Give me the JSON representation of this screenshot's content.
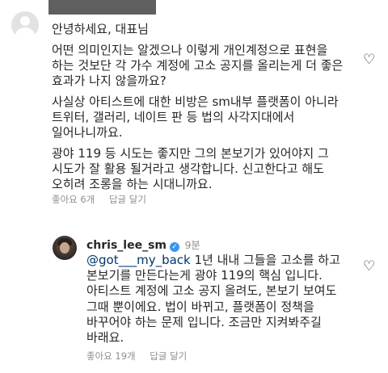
{
  "comment1": {
    "lines": [
      "안녕하세요, 대표님",
      "어떤 의미인지는 알겠으나 이렇게 개인계정으로 표현을 하는 것보단 각 가수 계정에 고소 공지를 올리는게 더 좋은 효과가 나지 않을까요?",
      "사실상 아티스트에 대한 비방은 sm내부 플랫폼이 아니라 트위터, 갤러리, 네이트 판 등 법의 사각지대에서 일어나니까요.",
      "광야 119 등 시도는 좋지만 그의 본보기가 있어야지 그 시도가 잘 활용 될거라고 생각합니다. 신고한다고 해도 오히려 조롱을 하는 시대니까요."
    ],
    "likes": "좋아요 6개",
    "reply": "답글 달기"
  },
  "comment2": {
    "username": "chris_lee_sm",
    "verified_mark": "✓",
    "time": "9분",
    "mention": "@got___my_back",
    "text": " 1년 내내 그들을 고소를 하고 본보기를 만든다는게 광야 119의 핵심 입니다. 아티스트 계정에  고소 공지 올려도, 본보기 보여도 그때 뿐이에요. 법이 바뀌고, 플랫폼이 정책을 바꾸어야 하는 문제 입니다. 조금만 지켜봐주길 바래요.",
    "likes": "좋아요 19개",
    "reply": "답글 달기"
  },
  "icons": {
    "heart": "♡"
  }
}
